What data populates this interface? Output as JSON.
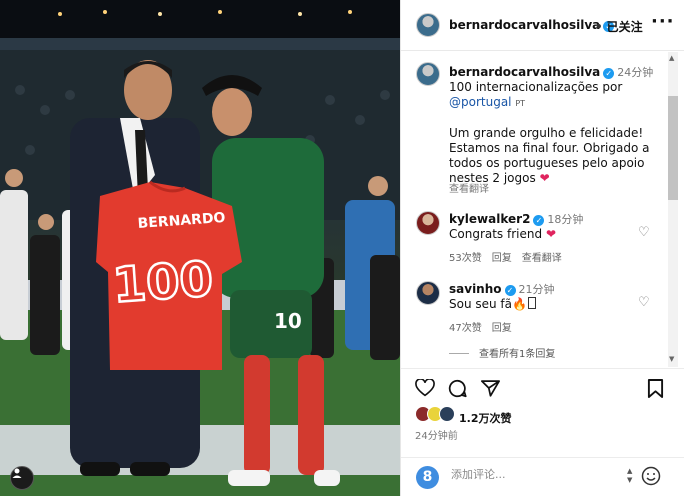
{
  "photo": {
    "shirt_name": "BERNARDO",
    "shirt_number": "100",
    "player_number": "10"
  },
  "post": {
    "username": "bernardocarvalhosilva",
    "follow_label": "已关注",
    "more_label": "···",
    "caption": {
      "time": "24分钟",
      "line1": "100 internacionalizações por",
      "mention": "@portugal",
      "mention_tag": "PT",
      "line3": "Um grande orgulho e felicidade!",
      "line4": "Estamos na final four. Obrigado a",
      "line5": "todos os portugueses pelo apoio",
      "line6": "nestes 2 jogos",
      "translate": "查看翻译"
    },
    "comments": [
      {
        "user": "kylewalker2",
        "time": "18分钟",
        "text": "Congrats friend",
        "likes": "53次赞",
        "reply": "回复",
        "translate": "查看翻译"
      },
      {
        "user": "savinho",
        "time": "21分钟",
        "text": "Sou seu fã",
        "likes": "47次赞",
        "reply": "回复"
      }
    ],
    "view_replies": "查看所有1条回复",
    "like_count": "1.2万次赞",
    "post_time": "24分钟前",
    "comment_placeholder": "添加评论...",
    "commenter_initial": "8"
  },
  "colors": {
    "verified": "#1d9bf0",
    "mention": "#1a56a6",
    "heart": "#e0245e",
    "jersey_red": "#e23b2e",
    "jacket_green": "#1e6b3a"
  }
}
